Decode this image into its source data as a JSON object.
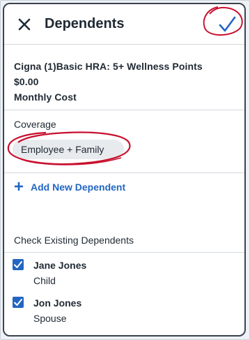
{
  "header": {
    "title": "Dependents",
    "close_icon": "close-icon",
    "done_icon": "checkmark-icon",
    "done_color": "#2266c2",
    "annotation_color": "#c8102e"
  },
  "plan": {
    "name": "Cigna (1)Basic HRA: 5+ Wellness Points",
    "cost": "$0.00",
    "cost_label": "Monthly Cost"
  },
  "coverage": {
    "label": "Coverage",
    "selected": "Employee + Family"
  },
  "add_dependent": {
    "label": "Add New Dependent",
    "icon": "plus-icon"
  },
  "existing": {
    "label": "Check Existing Dependents",
    "dependents": [
      {
        "name": "Jane Jones",
        "relationship": "Child",
        "checked": true
      },
      {
        "name": "Jon Jones",
        "relationship": "Spouse",
        "checked": true
      }
    ]
  }
}
